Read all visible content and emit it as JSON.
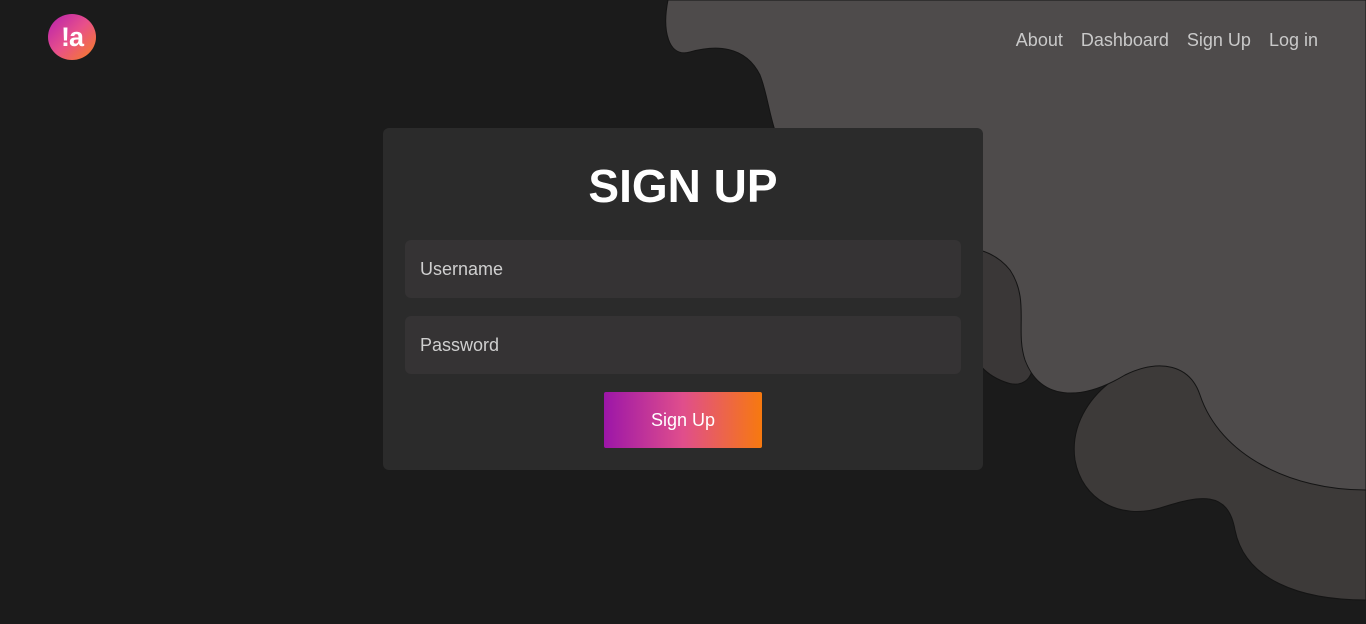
{
  "brand": {
    "logo_text": "!a"
  },
  "nav": {
    "items": [
      {
        "label": "About"
      },
      {
        "label": "Dashboard"
      },
      {
        "label": "Sign Up"
      },
      {
        "label": "Log in"
      }
    ]
  },
  "form": {
    "title": "SIGN UP",
    "username_placeholder": "Username",
    "password_placeholder": "Password",
    "submit_label": "Sign Up"
  },
  "colors": {
    "background": "#1b1b1b",
    "card": "#2b2b2b",
    "input": "#353334",
    "blob_light": "#4e4b4b",
    "blob_dark": "#3d3a39",
    "accent_start": "#9c16a8",
    "accent_mid": "#e04e8c",
    "accent_end": "#f7790f"
  }
}
